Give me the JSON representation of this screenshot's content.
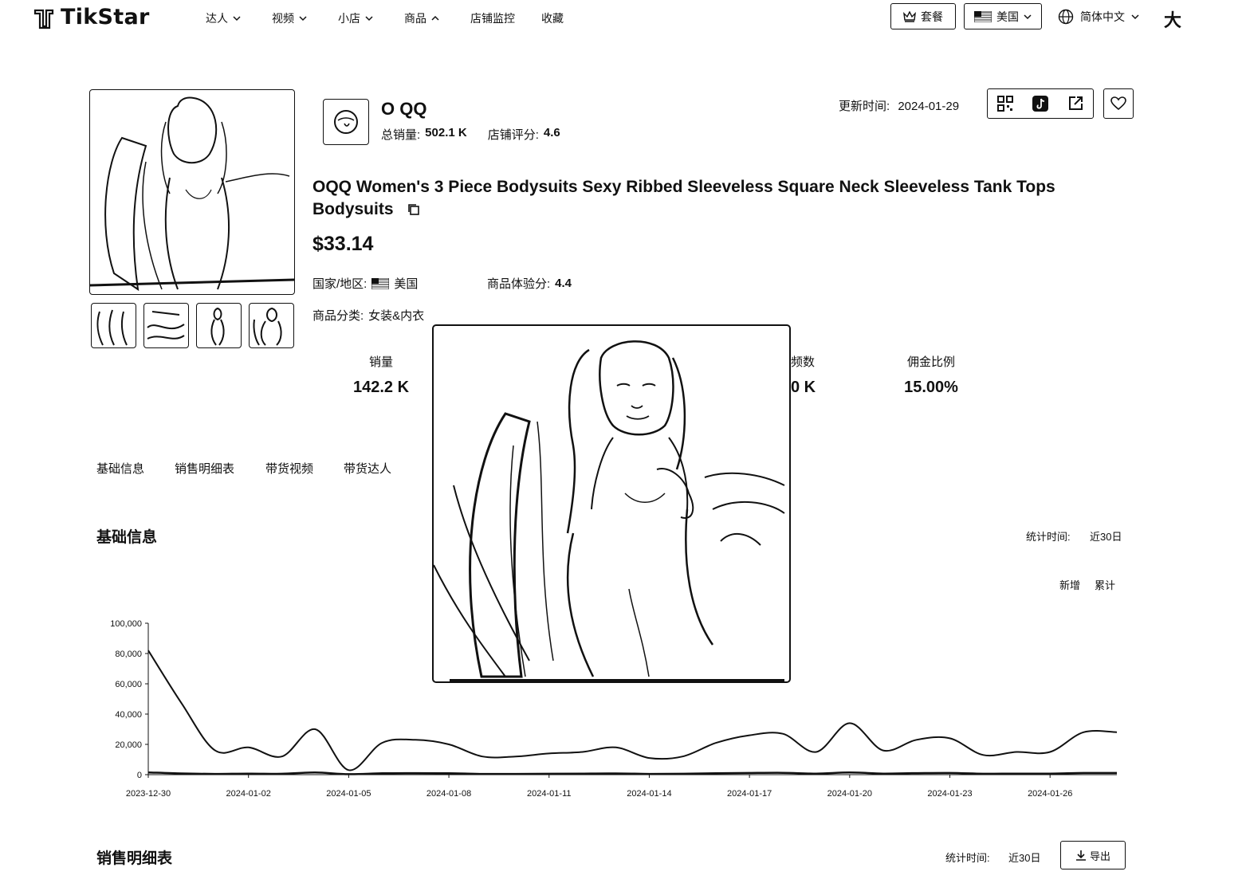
{
  "brand": {
    "name": "TikStar"
  },
  "nav": {
    "items": [
      {
        "label": "达人"
      },
      {
        "label": "视频"
      },
      {
        "label": "小店"
      },
      {
        "label": "商品"
      },
      {
        "label": "店铺监控"
      },
      {
        "label": "收藏"
      }
    ],
    "plan_label": "套餐",
    "region_label": "美国",
    "language_label": "简体中文",
    "size_toggle": "大"
  },
  "shop": {
    "name": "O QQ",
    "total_sales_label": "总销量:",
    "total_sales_value": "502.1 K",
    "rating_label": "店铺评分:",
    "rating_value": "4.6"
  },
  "update": {
    "label": "更新时间:",
    "value": "2024-01-29"
  },
  "product": {
    "title": "OQQ Women's 3 Piece Bodysuits Sexy Ribbed Sleeveless Square Neck Sleeveless Tank Tops Bodysuits",
    "price": "$33.14",
    "country_label": "国家/地区:",
    "country_value": "美国",
    "experience_label": "商品体验分:",
    "experience_value": "4.4",
    "category_label": "商品分类:",
    "category_value": "女装&内衣"
  },
  "stats": {
    "sales_label": "销量",
    "sales_value": "142.2 K",
    "videos_label_partial": "频数",
    "videos_value_partial": "0 K",
    "commission_label": "佣金比例",
    "commission_value": "15.00%"
  },
  "tabs": [
    {
      "label": "基础信息"
    },
    {
      "label": "销售明细表"
    },
    {
      "label": "带货视频"
    },
    {
      "label": "带货达人"
    }
  ],
  "basic_info": {
    "title": "基础信息",
    "period_label": "统计时间:",
    "period_value": "近30日",
    "toggle_new": "新增",
    "toggle_total": "累计"
  },
  "sales_detail": {
    "title": "销售明细表",
    "period_label": "统计时间:",
    "period_value": "近30日",
    "export_label": "导出"
  },
  "colors": {
    "ink": "#111111",
    "background": "#ffffff"
  },
  "icons": {
    "logo": "tikstar-logo-icon",
    "plan": "crown-icon",
    "region_flag": "us-flag-icon",
    "language": "globe-icon",
    "qr": "qr-code-icon",
    "tiktok": "tiktok-icon",
    "external": "external-link-icon",
    "favorite": "heart-icon",
    "copy": "copy-icon",
    "export": "download-icon"
  },
  "chart_data": {
    "type": "line",
    "ylim": [
      0,
      100000
    ],
    "y_ticks": [
      "0",
      "20,000",
      "40,000",
      "60,000",
      "80,000",
      "100,000"
    ],
    "x_tick_labels": [
      "2023-12-30",
      "2024-01-02",
      "2024-01-05",
      "2024-01-08",
      "2024-01-11",
      "2024-01-14",
      "2024-01-17",
      "2024-01-20",
      "2024-01-23",
      "2024-01-26"
    ],
    "x": [
      "2023-12-30",
      "2023-12-31",
      "2024-01-01",
      "2024-01-02",
      "2024-01-03",
      "2024-01-04",
      "2024-01-05",
      "2024-01-06",
      "2024-01-07",
      "2024-01-08",
      "2024-01-09",
      "2024-01-10",
      "2024-01-11",
      "2024-01-12",
      "2024-01-13",
      "2024-01-14",
      "2024-01-15",
      "2024-01-16",
      "2024-01-17",
      "2024-01-18",
      "2024-01-19",
      "2024-01-20",
      "2024-01-21",
      "2024-01-22",
      "2024-01-23",
      "2024-01-24",
      "2024-01-25",
      "2024-01-26",
      "2024-01-27",
      "2024-01-28"
    ],
    "series": [
      {
        "values": [
          82000,
          47000,
          16000,
          18000,
          12000,
          30000,
          3000,
          21000,
          23000,
          20000,
          12000,
          12000,
          14000,
          15000,
          18000,
          11000,
          12000,
          21000,
          26000,
          27000,
          15000,
          34000,
          16000,
          23000,
          24000,
          13000,
          15000,
          15000,
          28000,
          28000
        ]
      },
      {
        "values": [
          1500,
          800,
          500,
          700,
          600,
          1400,
          300,
          900,
          1000,
          900,
          500,
          500,
          600,
          700,
          800,
          500,
          600,
          900,
          1100,
          1200,
          700,
          1400,
          700,
          1000,
          1100,
          600,
          700,
          700,
          1100,
          1100
        ]
      }
    ]
  }
}
